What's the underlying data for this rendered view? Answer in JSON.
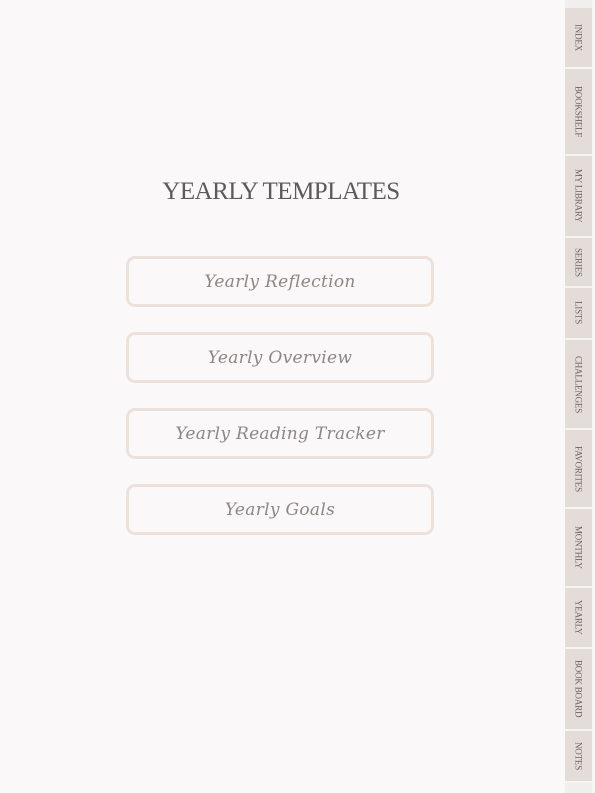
{
  "page": {
    "title": "YEARLY TEMPLATES"
  },
  "templates": [
    {
      "label": "Yearly Reflection"
    },
    {
      "label": "Yearly Overview"
    },
    {
      "label": "Yearly Reading Tracker"
    },
    {
      "label": "Yearly Goals"
    }
  ],
  "tabs": [
    {
      "label": "INDEX"
    },
    {
      "label": "BOOKSHELF"
    },
    {
      "label": "MY LIBRARY"
    },
    {
      "label": "SERIES"
    },
    {
      "label": "LISTS"
    },
    {
      "label": "CHALLENGES"
    },
    {
      "label": "FAVORITES"
    },
    {
      "label": "MONTHLY"
    },
    {
      "label": "YEARLY"
    },
    {
      "label": "BOOK BOARD"
    },
    {
      "label": "NOTES"
    }
  ],
  "colors": {
    "background": "#faf8f8",
    "tab_fill": "#e3dcd9",
    "button_border": "#ece2da",
    "title_text": "#5b5b5b",
    "button_text": "#8c8784"
  }
}
